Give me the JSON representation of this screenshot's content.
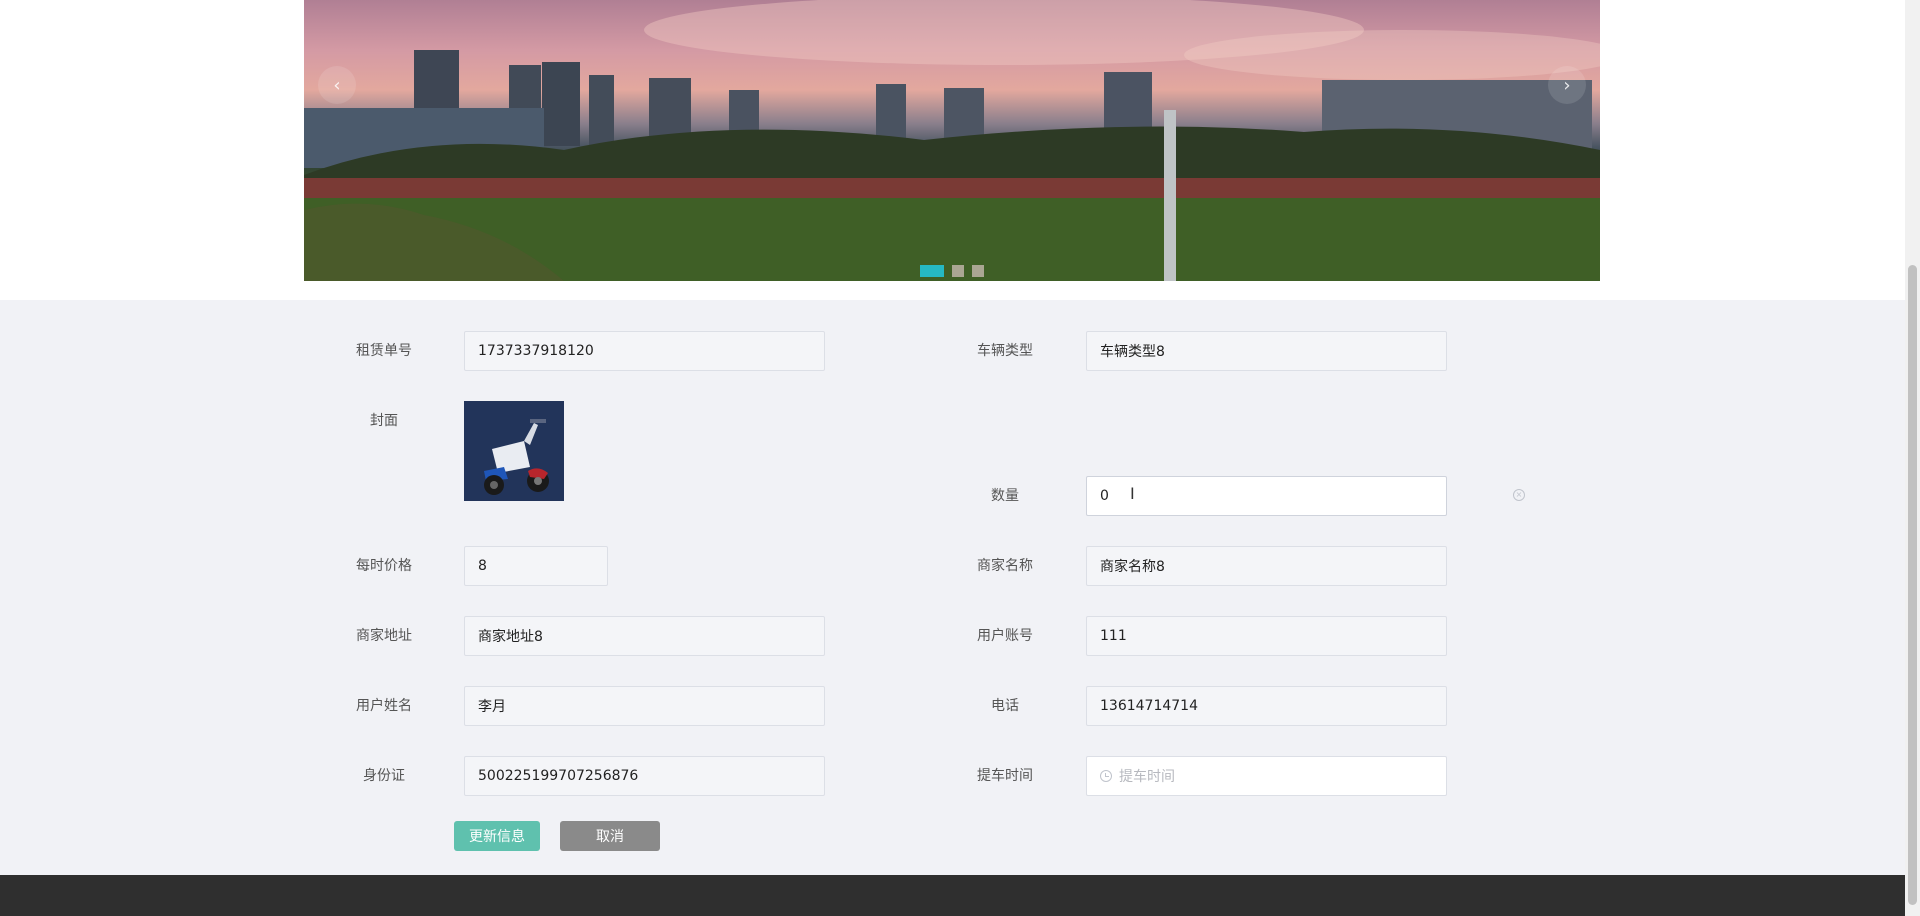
{
  "carousel": {
    "prev_glyph": "‹",
    "next_glyph": "›",
    "dot_count": 3,
    "active_dot": 0
  },
  "form": {
    "order_no": {
      "label": "租赁单号",
      "value": "1737337918120"
    },
    "vehicle_type": {
      "label": "车辆类型",
      "value": "车辆类型8"
    },
    "cover": {
      "label": "封面"
    },
    "quantity": {
      "label": "数量",
      "value": "0"
    },
    "hourly_price": {
      "label": "每时价格",
      "value": "8"
    },
    "merchant_name": {
      "label": "商家名称",
      "value": "商家名称8"
    },
    "merchant_address": {
      "label": "商家地址",
      "value": "商家地址8"
    },
    "user_account": {
      "label": "用户账号",
      "value": "111"
    },
    "user_name": {
      "label": "用户姓名",
      "value": "李月"
    },
    "phone": {
      "label": "电话",
      "value": "13614714714"
    },
    "id_card": {
      "label": "身份证",
      "value": "500225199707256876"
    },
    "pickup_time": {
      "label": "提车时间",
      "placeholder": "提车时间"
    }
  },
  "buttons": {
    "update": "更新信息",
    "cancel": "取消"
  },
  "icons": {
    "clock": "clock-icon",
    "clear": "circle-close-icon"
  },
  "colors": {
    "accent": "#26b9c4",
    "update_button": "#5fc1ae",
    "cancel_button": "#8a8a8a",
    "footer": "#2f2f2f"
  }
}
